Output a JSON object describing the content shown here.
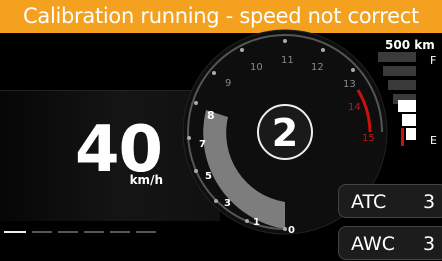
{
  "banner": {
    "text": "Calibration running - speed not correct"
  },
  "speed": {
    "value": "40",
    "unit": "km/h"
  },
  "gear": "2",
  "tach": {
    "labels": [
      "0",
      "1",
      "3",
      "5",
      "7",
      "8",
      "9",
      "10",
      "11",
      "12",
      "13",
      "14",
      "15"
    ],
    "redline_labels": [
      "14",
      "15"
    ]
  },
  "fuel": {
    "range": "500 km",
    "full": "F",
    "empty": "E",
    "level": 0.4
  },
  "assists": {
    "atc": {
      "label": "ATC",
      "value": "3"
    },
    "awc": {
      "label": "AWC",
      "value": "3"
    }
  },
  "colors": {
    "banner": "#f4a11f",
    "redline": "#cc1111",
    "needle_fill": "#808080"
  }
}
